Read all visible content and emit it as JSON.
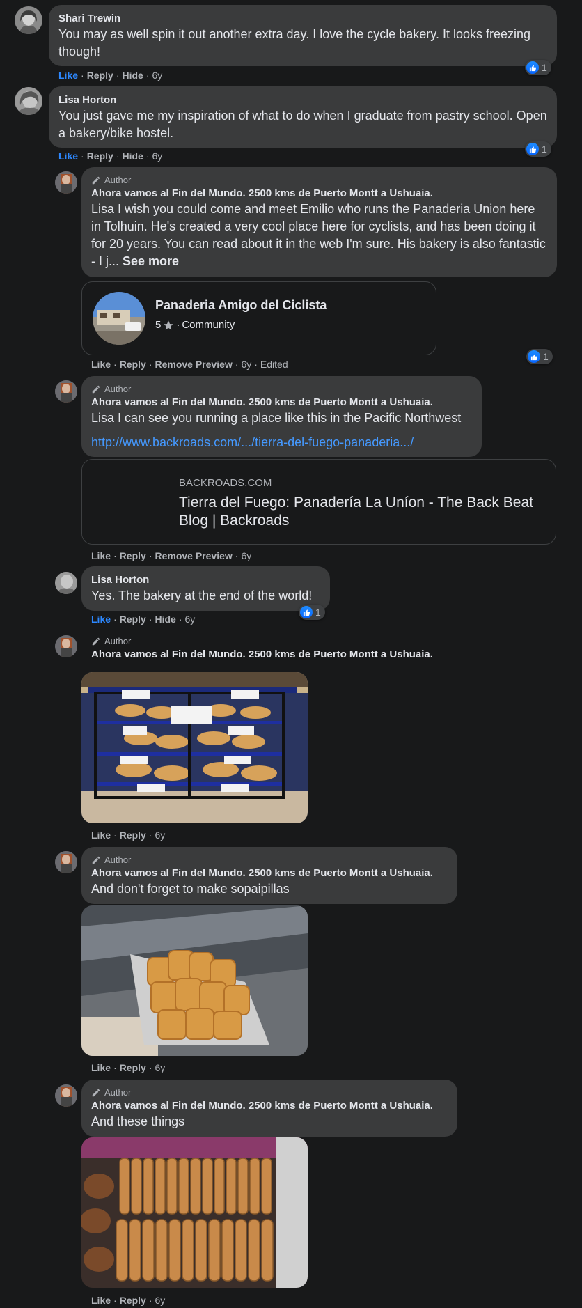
{
  "actions": {
    "like": "Like",
    "reply": "Reply",
    "hide": "Hide",
    "remove_preview": "Remove Preview",
    "time": "6y",
    "edited": "Edited",
    "see_more": "See more"
  },
  "author_badge": "Author",
  "comments": [
    {
      "name": "Shari Trewin",
      "text": "You may as well spin it out another extra day. I love the cycle bakery. It looks freezing though!",
      "reactions": "1"
    },
    {
      "name": "Lisa Horton",
      "text": "You just gave me my inspiration of what to do when I graduate from pastry school. Open a bakery/bike hostel.",
      "reactions": "1"
    }
  ],
  "replies": [
    {
      "name": "Ahora vamos al Fin del Mundo. 2500 kms de Puerto Montt a Ushuaia.",
      "text": "Lisa I wish you could come and meet Emilio who runs the Panaderia Union here in Tolhuin. He's created a very cool place here for cyclists, and has been doing it for 20 years. You can read about it in the web I'm sure. His bakery is also fantastic - I j...",
      "reactions": "1",
      "card": {
        "title": "Panaderia Amigo del Ciclista",
        "rating": "5",
        "category": "Community"
      }
    },
    {
      "name": "Ahora vamos al Fin del Mundo. 2500 kms de Puerto Montt a Ushuaia.",
      "text": "Lisa I can see you running a place like this in the Pacific Northwest",
      "link": "http://www.backroads.com/.../tierra-del-fuego-panaderia.../",
      "card": {
        "domain": "BACKROADS.COM",
        "title": "Tierra del Fuego: Panadería La Uníon - The Back Beat Blog | Backroads"
      }
    },
    {
      "name": "Lisa Horton",
      "text": "Yes. The bakery at the end of the world!",
      "reactions": "1"
    },
    {
      "name": "Ahora vamos al Fin del Mundo. 2500 kms de Puerto Montt a Ushuaia."
    },
    {
      "name": "Ahora vamos al Fin del Mundo. 2500 kms de Puerto Montt a Ushuaia.",
      "text": "And don't forget to make sopaipillas"
    },
    {
      "name": "Ahora vamos al Fin del Mundo. 2500 kms de Puerto Montt a Ushuaia.",
      "text": "And these things"
    }
  ],
  "colors": {
    "background": "#18191a",
    "bubble": "#3a3b3c",
    "like_blue": "#2d88ff",
    "link": "#4599ff"
  },
  "icons": [
    "like-icon",
    "pencil-icon",
    "star-icon"
  ]
}
